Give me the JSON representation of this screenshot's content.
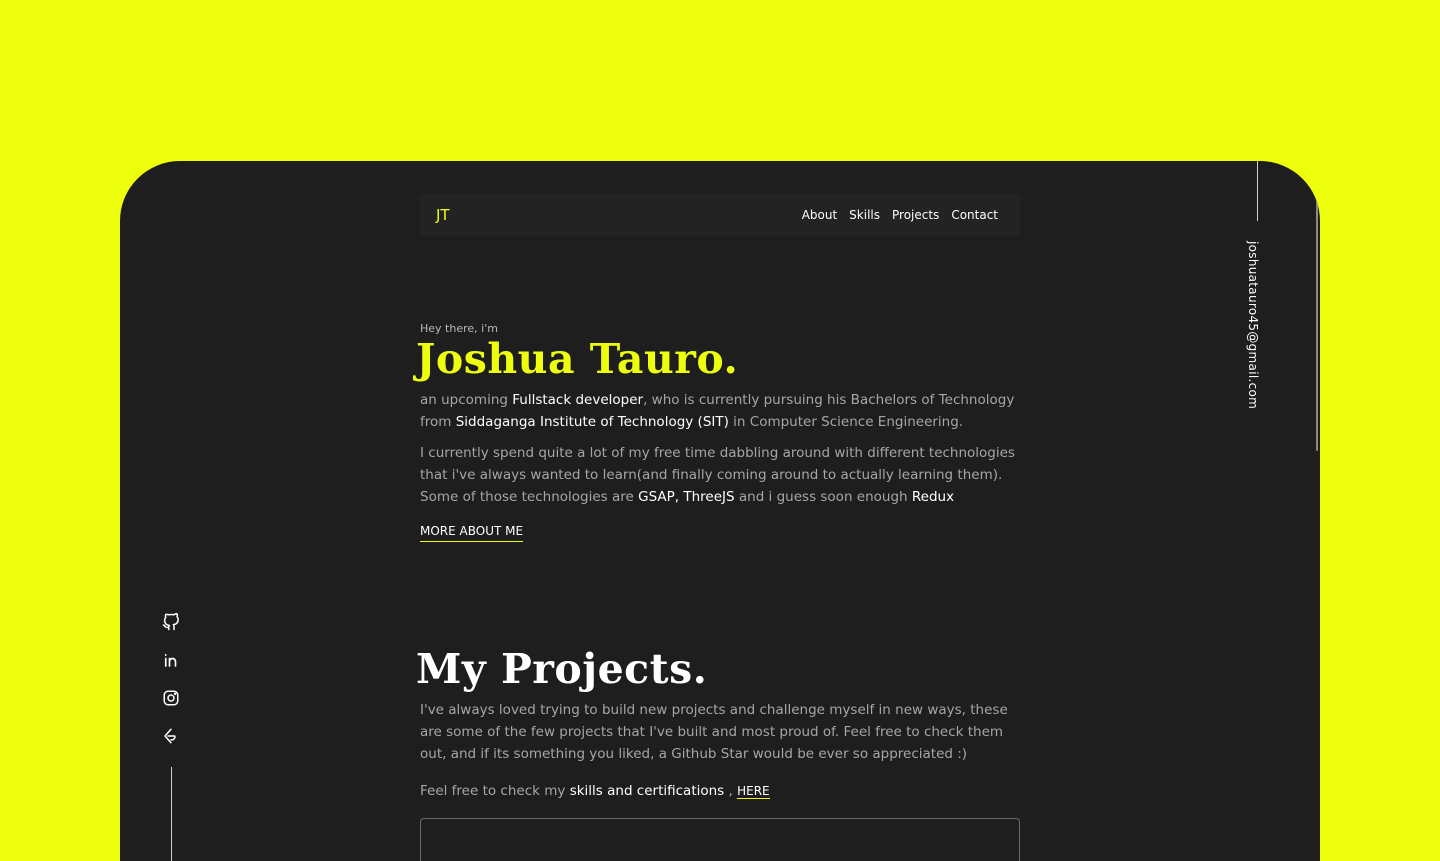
{
  "colors": {
    "accent": "#eeff0e",
    "page_bg": "#1e1e1e",
    "outer_bg": "#eeff0e"
  },
  "nav": {
    "logo": "JT",
    "links": [
      "About",
      "Skills",
      "Projects",
      "Contact"
    ]
  },
  "hero": {
    "greeting": "Hey there, i'm",
    "name": "Joshua Tauro.",
    "intro": {
      "t1": "an upcoming ",
      "b1": "Fullstack developer",
      "t2": ", who is currently pursuing his Bachelors of Technology from ",
      "b2": "Siddaganga Institute of Technology (SIT)",
      "t3": " in Computer Science Engineering."
    },
    "detail": {
      "t1": "I currently spend quite a lot of my free time dabbling around with different technologies that i've always wanted to learn(and finally coming around to actually learning them). Some of those technologies are ",
      "b1": "GSAP, ThreeJS",
      "t2": " and i guess soon enough ",
      "b2": "Redux"
    },
    "more_link": "MORE ABOUT ME"
  },
  "projects": {
    "title": "My Projects.",
    "description": "I've always loved trying to build new projects and challenge myself in new ways, these are some of the few projects that I've built and most proud of. Feel free to check them out, and if its something you liked, a Github Star would be ever so appreciated :)",
    "check": {
      "t1": "Feel free to check my ",
      "b1": "skills and certifications",
      "t2": " , ",
      "link": "HERE"
    }
  },
  "socials": [
    {
      "icon": "github-icon"
    },
    {
      "icon": "linkedin-icon"
    },
    {
      "icon": "instagram-icon"
    },
    {
      "icon": "hashnode-icon"
    }
  ],
  "email": "joshuatauro45@gmail.com"
}
